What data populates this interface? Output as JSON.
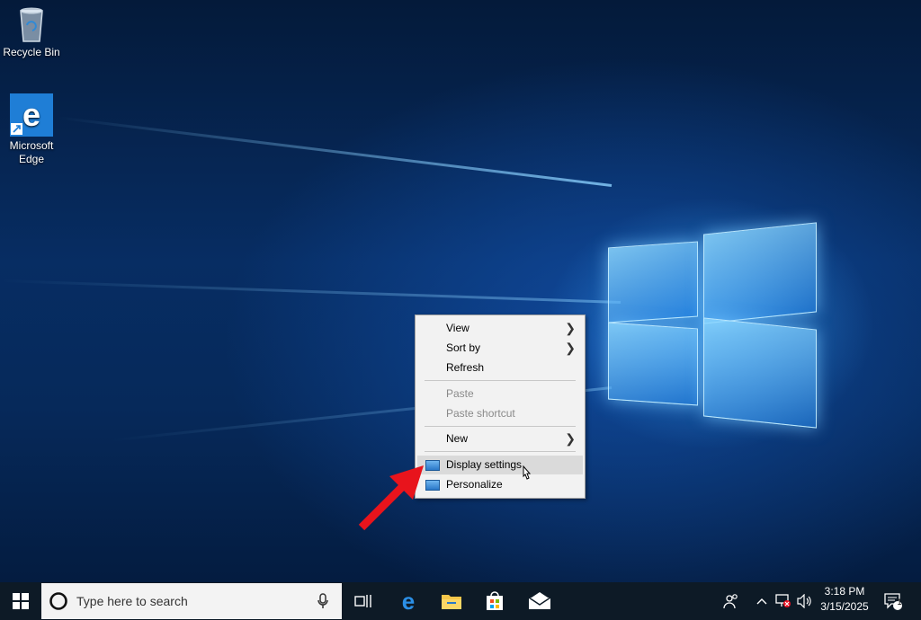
{
  "desktop": {
    "icons": [
      {
        "label": "Recycle Bin",
        "icon": "recycle-bin-icon"
      },
      {
        "label": "Microsoft Edge",
        "icon": "edge-icon"
      }
    ]
  },
  "context_menu": {
    "items": [
      {
        "label": "View",
        "submenu": true,
        "enabled": true
      },
      {
        "label": "Sort by",
        "submenu": true,
        "enabled": true
      },
      {
        "label": "Refresh",
        "submenu": false,
        "enabled": true
      },
      {
        "label": "Paste",
        "submenu": false,
        "enabled": false
      },
      {
        "label": "Paste shortcut",
        "submenu": false,
        "enabled": false
      },
      {
        "label": "New",
        "submenu": true,
        "enabled": true
      },
      {
        "label": "Display settings",
        "submenu": false,
        "enabled": true,
        "highlighted": true,
        "icon": "display-icon"
      },
      {
        "label": "Personalize",
        "submenu": false,
        "enabled": true,
        "icon": "personalize-icon"
      }
    ]
  },
  "taskbar": {
    "search_placeholder": "Type here to search",
    "time": "3:18 PM",
    "date": "3/15/2025",
    "notification_count": "1",
    "apps": [
      "task-view-icon",
      "edge-icon",
      "file-explorer-icon",
      "store-icon",
      "mail-icon"
    ]
  },
  "colors": {
    "annotation_arrow": "#e8141c",
    "taskbar": "#0d1a26",
    "menu_background": "#f2f2f2"
  }
}
